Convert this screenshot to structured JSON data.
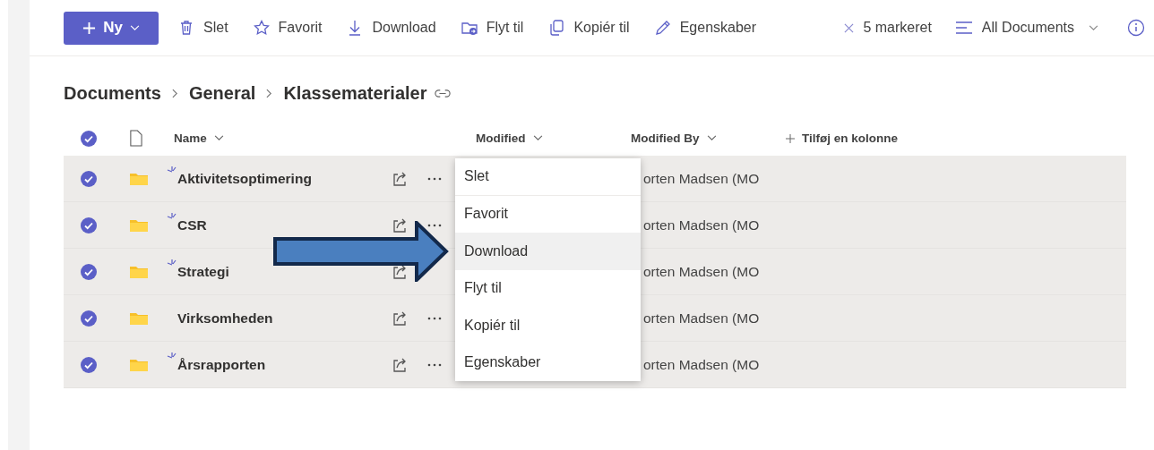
{
  "toolbar": {
    "new_button": "Ny",
    "actions": [
      {
        "label": "Slet"
      },
      {
        "label": "Favorit"
      },
      {
        "label": "Download"
      },
      {
        "label": "Flyt til"
      },
      {
        "label": "Kopiér til"
      },
      {
        "label": "Egenskaber"
      }
    ],
    "selection": "5 markeret",
    "view": "All Documents"
  },
  "breadcrumb": [
    "Documents",
    "General",
    "Klassematerialer"
  ],
  "table": {
    "all_selected": true,
    "columns": [
      "Name",
      "Modified",
      "Modified By",
      "Tilføj en kolonne"
    ],
    "rows": [
      {
        "name": "Aktivitetsoptimering",
        "new": true,
        "selected": true,
        "modified_by": "orten Madsen (MO"
      },
      {
        "name": "CSR",
        "new": true,
        "selected": true,
        "modified_by": "orten Madsen (MO"
      },
      {
        "name": "Strategi",
        "new": true,
        "selected": true,
        "modified_by": "orten Madsen (MO"
      },
      {
        "name": "Virksomheden",
        "new": false,
        "selected": true,
        "modified_by": "orten Madsen (MO"
      },
      {
        "name": "Årsrapporten",
        "new": true,
        "selected": true,
        "modified_by": "orten Madsen (MO"
      }
    ]
  },
  "context_menu": [
    {
      "label": "Slet",
      "selected": false
    },
    {
      "label": "Favorit",
      "selected": false
    },
    {
      "label": "Download",
      "selected": true
    },
    {
      "label": "Flyt til",
      "selected": false
    },
    {
      "label": "Kopiér til",
      "selected": false
    },
    {
      "label": "Egenskaber",
      "selected": false
    }
  ]
}
